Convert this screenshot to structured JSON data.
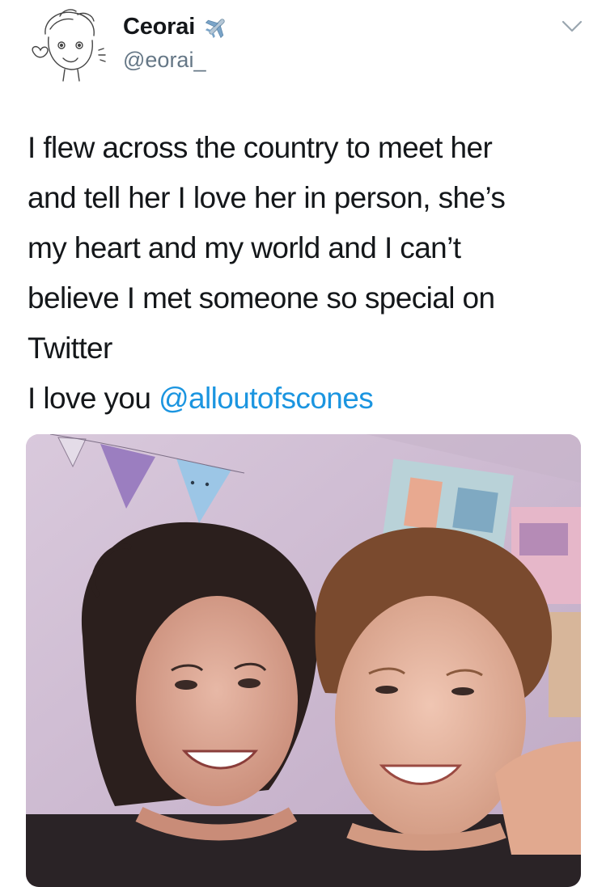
{
  "author": {
    "display_name": "Ceorai",
    "handle": "@eorai_",
    "name_emoji": "airplane-icon"
  },
  "tweet": {
    "lines": [
      "I flew across the country to meet her",
      "and tell her I love her in person, she’s",
      "my heart and my world and I can’t",
      "believe I met someone so special on",
      "Twitter"
    ],
    "closing_text": "I love you ",
    "mention": "@alloutofscones"
  },
  "media": {
    "type": "photo"
  },
  "colors": {
    "text": "#14171a",
    "secondary": "#657786",
    "link": "#1b95e0"
  }
}
